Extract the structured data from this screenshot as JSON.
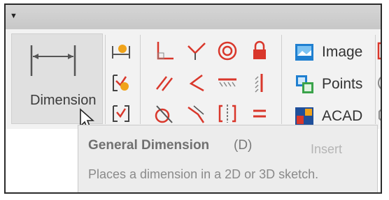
{
  "ribbon": {
    "dimension_label": "Dimension"
  },
  "insert": {
    "items": [
      {
        "label": "Image",
        "icon": "image-icon"
      },
      {
        "label": "Points",
        "icon": "points-icon"
      },
      {
        "label": "ACAD",
        "icon": "acad-icon"
      }
    ],
    "group_label": "Insert"
  },
  "tooltip": {
    "title": "General Dimension",
    "shortcut": "(D)",
    "description": "Places a dimension in a 2D or 3D sketch."
  },
  "colors": {
    "accent_red": "#d9372b",
    "accent_orange": "#f0a31a",
    "icon_blue": "#1f7fd0",
    "icon_green": "#3aa34a"
  }
}
